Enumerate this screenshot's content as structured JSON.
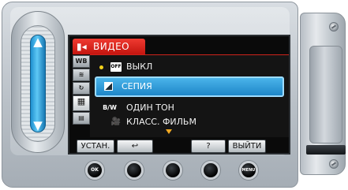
{
  "tab": {
    "icon": "video-camera-icon",
    "label": "ВИДЕО"
  },
  "side_tabs": [
    {
      "name": "wb-tab",
      "icon": "WB"
    },
    {
      "name": "image-adjust-tab",
      "icon": "≋"
    },
    {
      "name": "refresh-tab",
      "icon": "↻"
    },
    {
      "name": "film-effect-tab",
      "icon": "🎬"
    },
    {
      "name": "settings-tab",
      "icon": "▤"
    }
  ],
  "menu": {
    "items": [
      {
        "icon": "OFF",
        "label": "ВЫКЛ",
        "current": true
      },
      {
        "icon": "sepia-icon",
        "label": "СЕПИЯ",
        "selected": true
      },
      {
        "icon": "B/W",
        "label": "ОДИН ТОН"
      },
      {
        "icon": "🎥",
        "label": "КЛАСС. ФИЛЬМ"
      }
    ]
  },
  "softkeys": {
    "set": "УСТАН.",
    "back": "↩",
    "help": "?",
    "exit": "ВЫЙТИ"
  },
  "hw_buttons": {
    "ok": "OK",
    "menu": "MENU"
  },
  "colors": {
    "tab_red": "#d9241c",
    "selection_blue": "#2a95d6",
    "slider_blue": "#3cb3ec",
    "current_dot": "#f4d21a"
  }
}
